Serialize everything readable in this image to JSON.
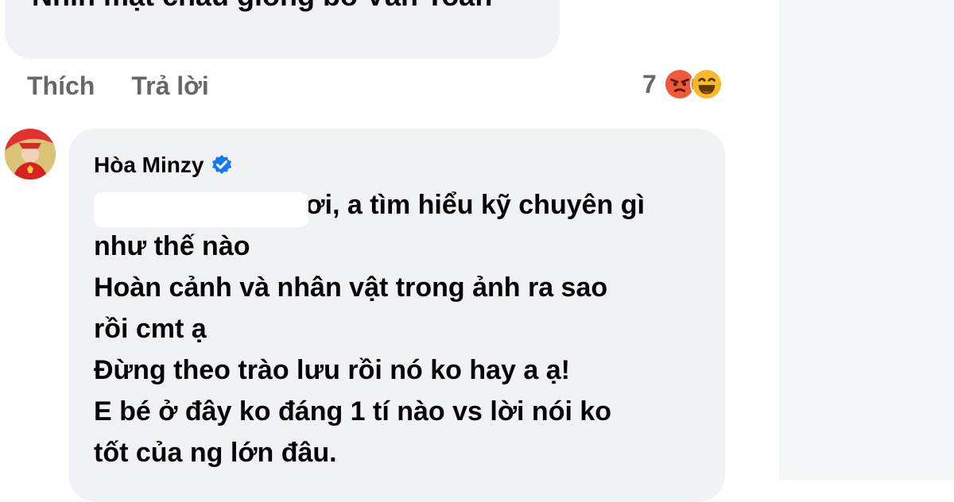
{
  "previous_comment": {
    "text": "Nhìn mặt cháu giống bố Văn Toàn",
    "actions": {
      "like": "Thích",
      "reply": "Trả lời"
    },
    "reactions": {
      "count": "7",
      "icons": [
        "angry-emoji",
        "laugh-emoji"
      ]
    }
  },
  "reply_comment": {
    "author": "Hòa Minzy",
    "verified": true,
    "lines": [
      "a ơi, a tìm hiểu kỹ chuyên gì",
      "như thế nào",
      "Hoàn cảnh và nhân vật trong ảnh ra sao",
      "rồi cmt ạ",
      "Đừng theo trào lưu rồi nó ko hay a ạ!",
      "E bé ở đây ko đáng 1 tí nào vs lời nói ko",
      "tốt của ng lớn đâu."
    ]
  },
  "colors": {
    "bubble": "#f0f2f5",
    "text": "#050505",
    "secondary_text": "#65676b",
    "verified_blue": "#1877f2",
    "angry_red": "#f05a3c",
    "laugh_yellow": "#f7b928"
  }
}
